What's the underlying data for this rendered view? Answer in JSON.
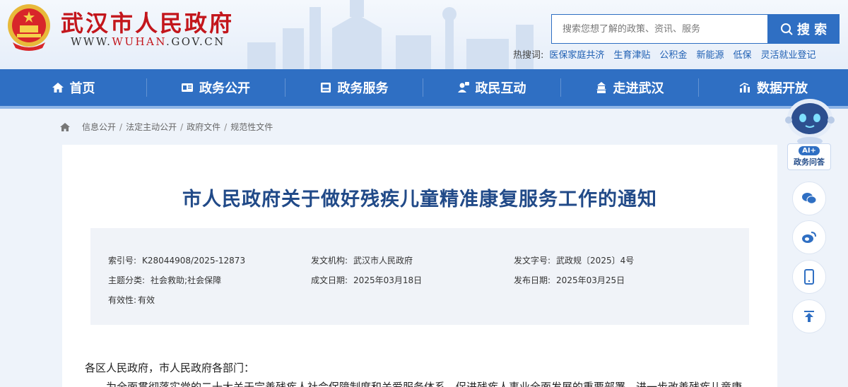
{
  "header": {
    "site_title": "武汉市人民政府",
    "domain_prefix": "WWW.",
    "domain_highlight": "WUHAN",
    "domain_suffix": ".GOV.CN",
    "search_placeholder": "搜索您想了解的政策、资讯、服务",
    "search_button": "搜 索",
    "hot_label": "热搜词:",
    "hot_words": [
      "医保家庭共济",
      "生育津贴",
      "公积金",
      "新能源",
      "低保",
      "灵活就业登记"
    ]
  },
  "nav": {
    "items": [
      {
        "label": "首页",
        "icon": "home-icon"
      },
      {
        "label": "政务公开",
        "icon": "news-icon"
      },
      {
        "label": "政务服务",
        "icon": "service-icon"
      },
      {
        "label": "政民互动",
        "icon": "interaction-icon"
      },
      {
        "label": "走进武汉",
        "icon": "city-icon"
      },
      {
        "label": "数据开放",
        "icon": "data-icon"
      }
    ]
  },
  "breadcrumb": [
    "信息公开",
    "法定主动公开",
    "政府文件",
    "规范性文件"
  ],
  "document": {
    "title": "市人民政府关于做好残疾儿童精准康复服务工作的通知",
    "meta": {
      "index_no": {
        "label": "索引号:",
        "value": "K28044908/2025-12873"
      },
      "issuer": {
        "label": "发文机构:",
        "value": "武汉市人民政府"
      },
      "doc_no": {
        "label": "发文字号:",
        "value": "武政规〔2025〕4号"
      },
      "category": {
        "label": "主题分类:",
        "value": "社会救助;社会保障"
      },
      "created": {
        "label": "成文日期:",
        "value": "2025年03月18日"
      },
      "published": {
        "label": "发布日期:",
        "value": "2025年03月25日"
      },
      "validity": {
        "label": "有效性:",
        "value": "有效"
      }
    },
    "salutation": "各区人民政府，市人民政府各部门：",
    "body_first_line": "为全面贯彻落实党的二十大关于完善残疾人社会保障制度和关爱服务体系、促进残疾人事业全面发展的重要部署，进一步改善残疾儿童康"
  },
  "sidebar_tools": {
    "ai_badge": "AI+",
    "ai_label": "政务问答",
    "tools": [
      "wechat-icon",
      "weibo-icon",
      "mobile-icon",
      "back-to-top-icon"
    ]
  },
  "colors": {
    "brand_red": "#c3161c",
    "nav_blue": "#2f6fc3",
    "title_blue": "#214a88"
  }
}
